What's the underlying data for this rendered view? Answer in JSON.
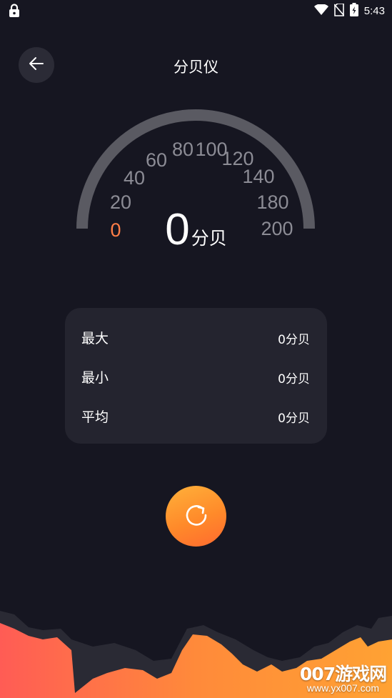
{
  "status_bar": {
    "time": "5:43"
  },
  "header": {
    "title": "分贝仪"
  },
  "gauge": {
    "ticks": [
      "0",
      "20",
      "40",
      "60",
      "80",
      "100",
      "120",
      "140",
      "180",
      "200"
    ],
    "active_tick_color": "#ff7e47",
    "tick_color": "#8c8c95",
    "arc_color": "#5a5a62"
  },
  "reading": {
    "value": "0",
    "unit": "分贝"
  },
  "stats": [
    {
      "label": "最大",
      "value": "0分贝"
    },
    {
      "label": "最小",
      "value": "0分贝"
    },
    {
      "label": "平均",
      "value": "0分贝"
    }
  ],
  "colors": {
    "accent_orange": "#ff9a32",
    "accent_red": "#ff5c55",
    "background": "#161621"
  },
  "icons": {
    "lock": "lock-icon",
    "wifi": "wifi-icon",
    "no_sim": "no-sim-icon",
    "battery": "battery-icon",
    "back": "back-arrow-icon",
    "reset": "refresh-icon"
  },
  "watermark": {
    "logo": "007游戏网",
    "url": "www.yx007.com"
  }
}
